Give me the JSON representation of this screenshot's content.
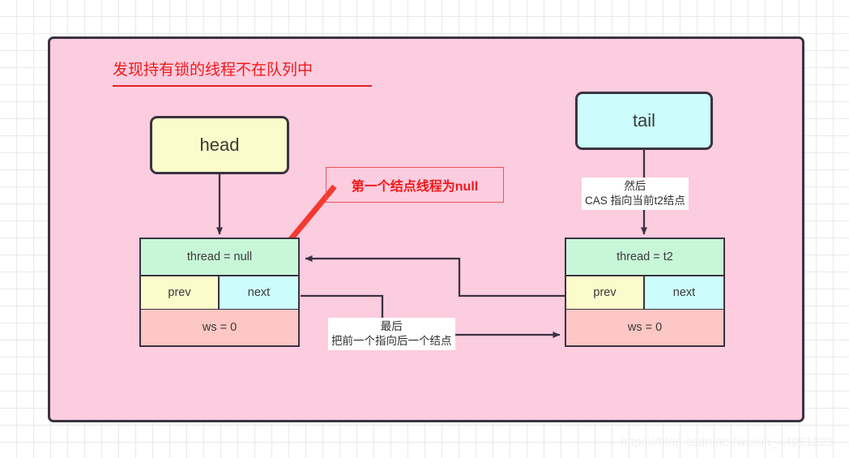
{
  "diagram": {
    "title": "发现持有锁的线程不在队列中",
    "background_color": "#fcccdf",
    "border_color": "#3b3340",
    "grid_color": "#e9e9e9"
  },
  "pointers": {
    "head": {
      "label": "head",
      "color": "#fbfbcc"
    },
    "tail": {
      "label": "tail",
      "color": "#ccfcfc"
    }
  },
  "nodes": [
    {
      "id": "left",
      "thread": "thread = null",
      "prev": "prev",
      "next": "next",
      "ws": "ws = 0",
      "thread_color": "#c8f7d8",
      "prev_color": "#fbfbcc",
      "next_color": "#ccfcfc",
      "ws_color": "#fcc7c4"
    },
    {
      "id": "right",
      "thread": "thread = t2",
      "prev": "prev",
      "next": "next",
      "ws": "ws = 0",
      "thread_color": "#c8f7d8",
      "prev_color": "#fbfbcc",
      "next_color": "#ccfcfc",
      "ws_color": "#fcc7c4"
    }
  ],
  "annotations": {
    "callout": {
      "text": "第一个结点线程为null",
      "color": "#f01a1a"
    },
    "cas_label_line1": "然后",
    "cas_label_line2": "CAS 指向当前t2结点",
    "last_label_line1": "最后",
    "last_label_line2": "把前一个指向后一个结点"
  },
  "watermark": "https://blog.csdn.net/weixin_44051223"
}
